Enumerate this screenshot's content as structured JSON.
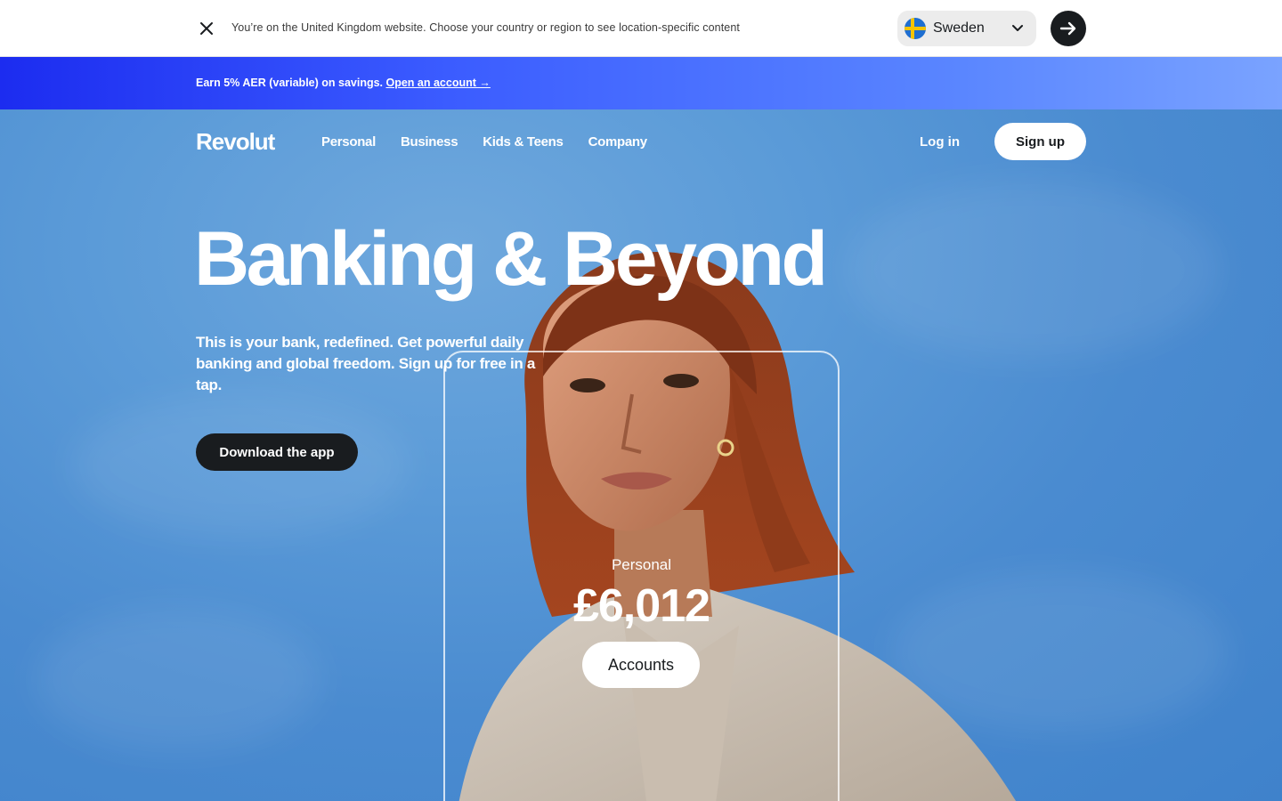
{
  "country_bar": {
    "message": "You’re on the United Kingdom website. Choose your country or region to see location-specific content",
    "selected_country": "Sweden",
    "close_icon": "close-icon",
    "go_icon": "arrow-right-icon"
  },
  "promo": {
    "text": "Earn 5% AER (variable) on savings. ",
    "link": "Open an account →"
  },
  "nav": {
    "logo": "Revolut",
    "items": [
      "Personal",
      "Business",
      "Kids & Teens",
      "Company"
    ],
    "login": "Log in",
    "signup": "Sign up"
  },
  "hero": {
    "headline": "Banking & Beyond",
    "subtext": "This is your bank, redefined. Get powerful daily banking and global freedom. Sign up for free in a tap.",
    "cta": "Download the app"
  },
  "card": {
    "label": "Personal",
    "amount": "£6,012",
    "button": "Accounts"
  },
  "colors": {
    "brand_dark": "#191c1f",
    "promo_start": "#1c2cf0",
    "promo_end": "#7aa3ff",
    "sky": "#4a8bd0"
  }
}
